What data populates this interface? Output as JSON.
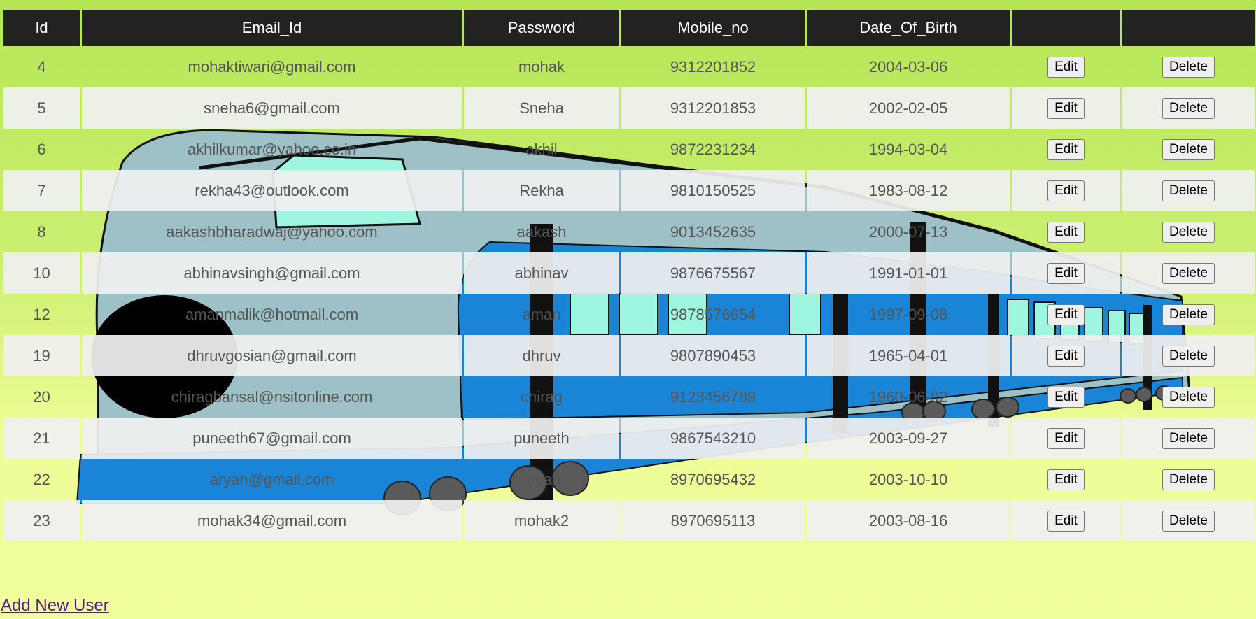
{
  "table": {
    "headers": [
      "Id",
      "Email_Id",
      "Password",
      "Mobile_no",
      "Date_Of_Birth",
      "",
      ""
    ],
    "rows": [
      {
        "id": "4",
        "email": "mohaktiwari@gmail.com",
        "password": "mohak",
        "mobile": "9312201852",
        "dob": "2004-03-06"
      },
      {
        "id": "5",
        "email": "sneha6@gmail.com",
        "password": "Sneha",
        "mobile": "9312201853",
        "dob": "2002-02-05"
      },
      {
        "id": "6",
        "email": "akhilkumar@yahoo.co.in",
        "password": "akhil",
        "mobile": "9872231234",
        "dob": "1994-03-04"
      },
      {
        "id": "7",
        "email": "rekha43@outlook.com",
        "password": "Rekha",
        "mobile": "9810150525",
        "dob": "1983-08-12"
      },
      {
        "id": "8",
        "email": "aakashbharadwaj@yahoo.com",
        "password": "aakash",
        "mobile": "9013452635",
        "dob": "2000-07-13"
      },
      {
        "id": "10",
        "email": "abhinavsingh@gmail.com",
        "password": "abhinav",
        "mobile": "9876675567",
        "dob": "1991-01-01"
      },
      {
        "id": "12",
        "email": "amanmalik@hotmail.com",
        "password": "aman",
        "mobile": "9878576654",
        "dob": "1997-09-08"
      },
      {
        "id": "19",
        "email": "dhruvgosian@gmail.com",
        "password": "dhruv",
        "mobile": "9807890453",
        "dob": "1965-04-01"
      },
      {
        "id": "20",
        "email": "chiragbansal@nsitonline.com",
        "password": "chirag",
        "mobile": "9123456789",
        "dob": "1960-06-02"
      },
      {
        "id": "21",
        "email": "puneeth67@gmail.com",
        "password": "puneeth",
        "mobile": "9867543210",
        "dob": "2003-09-27"
      },
      {
        "id": "22",
        "email": "aryan@gmail.com",
        "password": "aryan",
        "mobile": "8970695432",
        "dob": "2003-10-10"
      },
      {
        "id": "23",
        "email": "mohak34@gmail.com",
        "password": "mohak2",
        "mobile": "8970695113",
        "dob": "2003-08-16"
      }
    ],
    "edit_label": "Edit",
    "delete_label": "Delete"
  },
  "add_link": "Add New User",
  "colors": {
    "header_bg": "#222222",
    "background_top": "#b5e655",
    "background_bottom": "#f1fe9c",
    "row_light": "#f0f0f0",
    "link": "#551a8b",
    "train_body": "#9dc1c6",
    "train_stripe": "#1a85d6"
  },
  "background_image": "train-illustration"
}
